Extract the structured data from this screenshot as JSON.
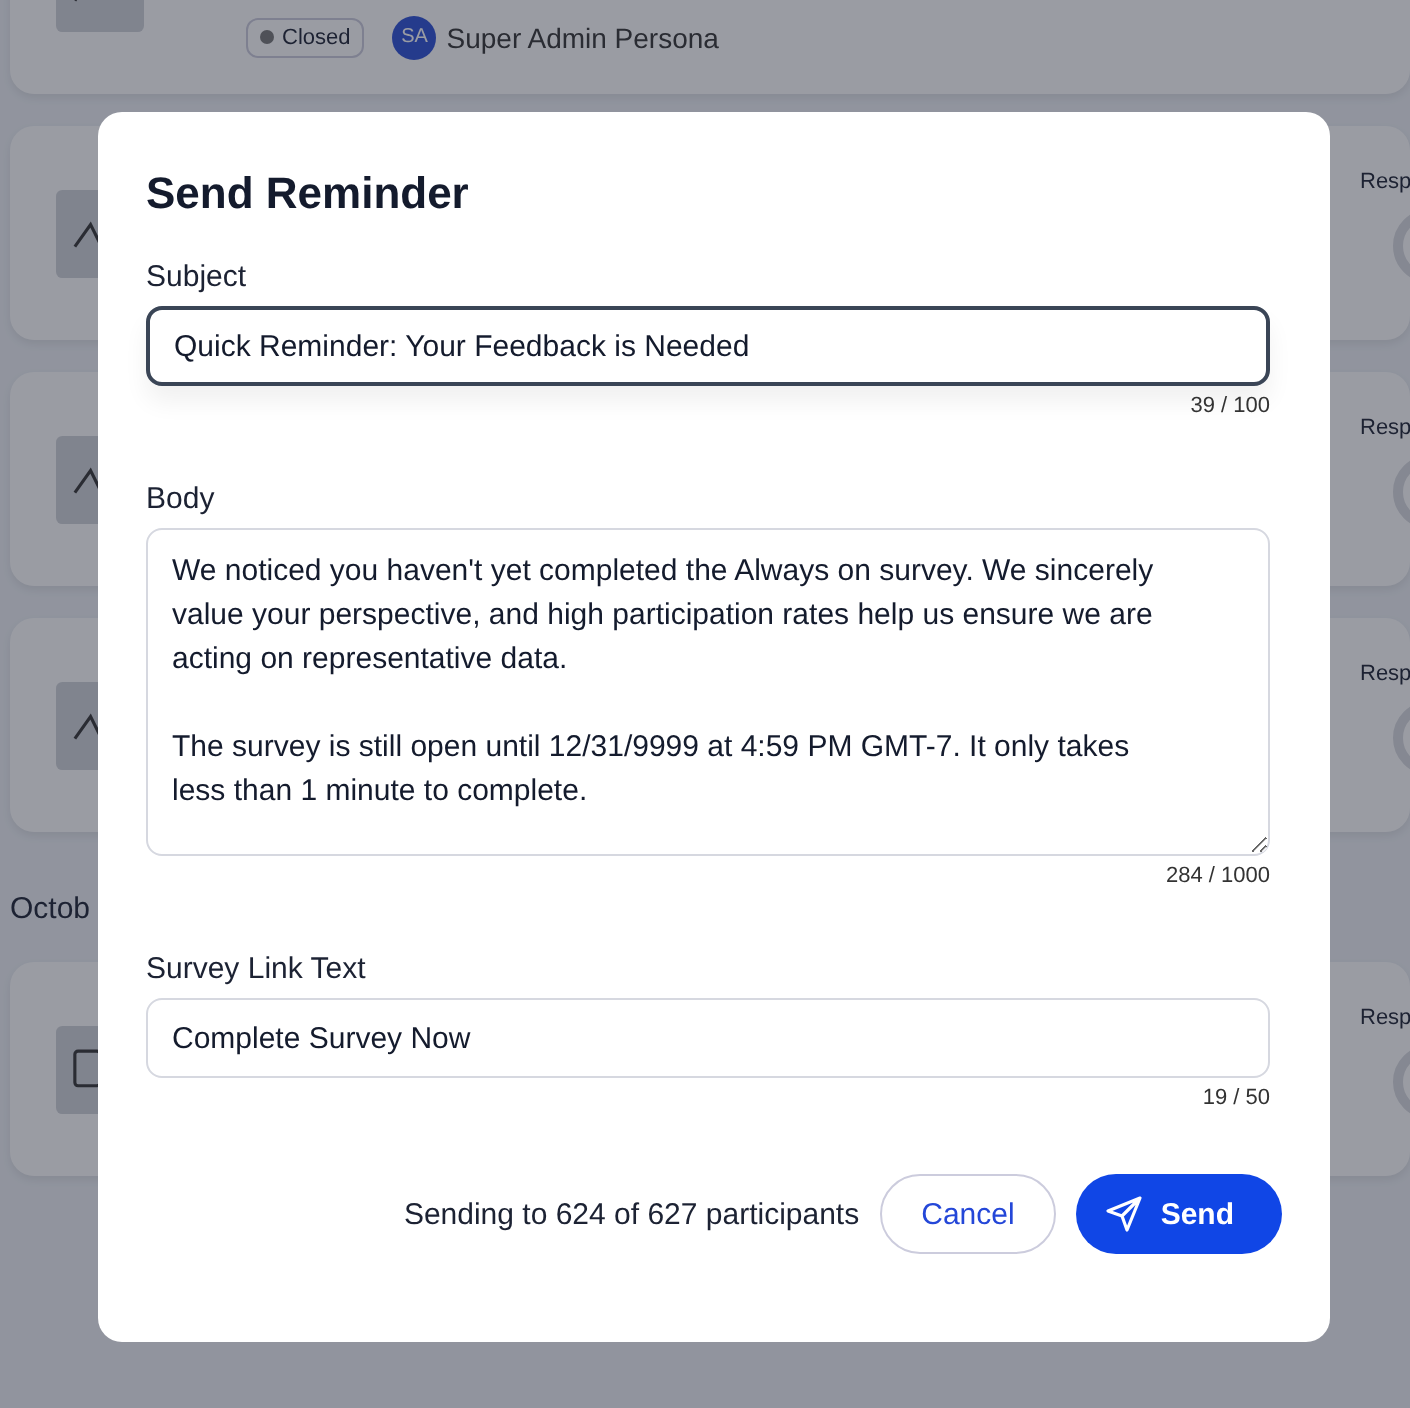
{
  "background": {
    "cards": [
      {
        "kind": "status",
        "status": "Closed",
        "avatar": "SA",
        "owner": "Super Admin Persona"
      },
      {
        "kind": "response",
        "label": "Resp"
      },
      {
        "kind": "response",
        "label": "Resp"
      },
      {
        "kind": "response",
        "label": "Resp"
      },
      {
        "kind": "heading",
        "text": "Octob"
      },
      {
        "kind": "response",
        "label": "Resp"
      }
    ]
  },
  "dialog": {
    "title": "Send Reminder",
    "fields": [
      {
        "kind": "input",
        "label": "Subject",
        "value": "Quick Reminder: Your Feedback is Needed",
        "counter": "39 / 100",
        "focused": true
      },
      {
        "kind": "textarea",
        "label": "Body",
        "value": "We noticed you haven't yet completed the Always on survey. We sincerely value your perspective, and high participation rates help us ensure we are acting on representative data.\n\nThe survey is still open until 12/31/9999 at 4:59 PM GMT-7. It only takes less than 1 minute to complete.",
        "counter": "284 / 1000",
        "focused": false
      },
      {
        "kind": "input",
        "label": "Survey Link Text",
        "value": "Complete Survey Now",
        "counter": "19 / 50",
        "focused": false
      }
    ],
    "recipients": "Sending to 624 of 627 participants",
    "buttons": [
      {
        "kind": "secondary",
        "label": "Cancel"
      },
      {
        "kind": "primary",
        "label": "Send"
      }
    ]
  }
}
